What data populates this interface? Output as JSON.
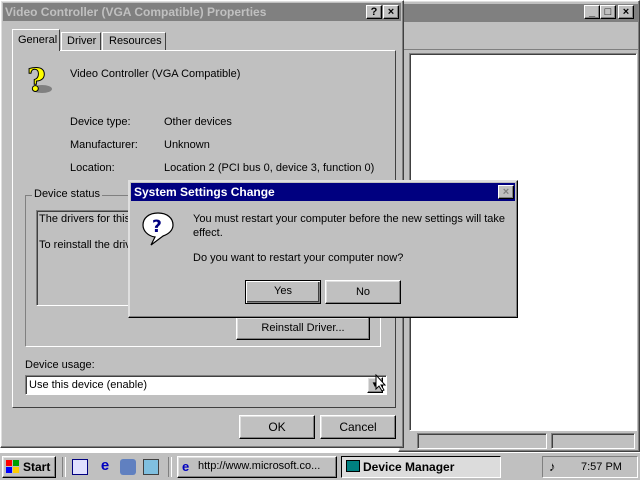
{
  "properties_window": {
    "title": "Video Controller (VGA Compatible) Properties",
    "help_btn": "?",
    "close_btn": "×",
    "tabs": [
      {
        "label": "General"
      },
      {
        "label": "Driver"
      },
      {
        "label": "Resources"
      }
    ],
    "device_name": "Video Controller (VGA Compatible)",
    "device_type_label": "Device type:",
    "device_type_value": "Other devices",
    "manufacturer_label": "Manufacturer:",
    "manufacturer_value": "Unknown",
    "location_label": "Location:",
    "location_value": "Location 2 (PCI bus 0, device 3, function 0)",
    "device_status_label": "Device status",
    "status_line1": "The drivers for this",
    "status_line2": "To reinstall the drive",
    "reinstall_button": "Reinstall Driver...",
    "device_usage_label": "Device usage:",
    "device_usage_value": "Use this device (enable)",
    "ok_button": "OK",
    "cancel_button": "Cancel"
  },
  "dialog": {
    "title": "System Settings Change",
    "close_btn": "×",
    "message_line1": "You must restart your computer before the new settings will take",
    "message_line2": "effect.",
    "question": "Do you want to restart your computer now?",
    "yes_button": "Yes",
    "no_button": "No"
  },
  "taskbar": {
    "start_label": "Start",
    "task_ie": "http://www.microsoft.co...",
    "task_devmgr": "Device Manager",
    "clock": "7:57 PM"
  },
  "colors": {
    "title_active": "#000080",
    "title_inactive": "#808080",
    "face": "#c0c0c0"
  }
}
